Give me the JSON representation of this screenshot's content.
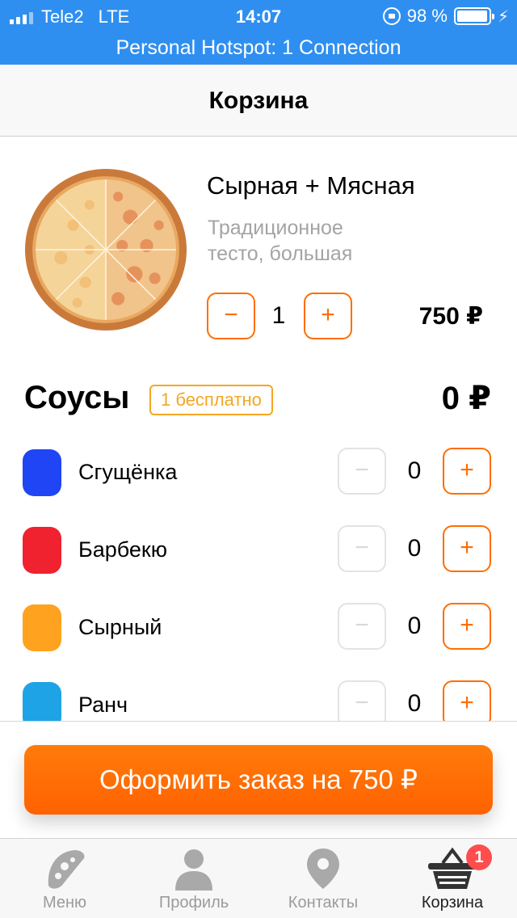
{
  "status_bar": {
    "carrier": "Tele2",
    "network": "LTE",
    "time": "14:07",
    "battery": "98 %",
    "battery_level": 0.98
  },
  "hotspot": "Personal Hotspot: 1 Connection",
  "nav": {
    "title": "Корзина"
  },
  "product": {
    "name": "Сырная + Мясная",
    "description": "Традиционное тесто, большая",
    "quantity": "1",
    "price": "750 ₽",
    "minus": "−",
    "plus": "+"
  },
  "sauces": {
    "title": "Соусы",
    "badge": "1 бесплатно",
    "total": "0 ₽",
    "items": [
      {
        "name": "Сгущёнка",
        "quantity": "0",
        "color": "#1f45f5"
      },
      {
        "name": "Барбекю",
        "quantity": "0",
        "color": "#f0222f"
      },
      {
        "name": "Сырный",
        "quantity": "0",
        "color": "#ffa21f"
      },
      {
        "name": "Ранч",
        "quantity": "0",
        "color": "#1ea3e6"
      }
    ]
  },
  "checkout": {
    "label": "Оформить заказ на 750 ₽"
  },
  "tabs": [
    {
      "label": "Меню",
      "icon": "pizza-slice-icon"
    },
    {
      "label": "Профиль",
      "icon": "person-icon"
    },
    {
      "label": "Контакты",
      "icon": "map-pin-icon"
    },
    {
      "label": "Корзина",
      "icon": "basket-icon",
      "badge": "1"
    }
  ],
  "colors": {
    "accent": "#ff6d00",
    "status_bar": "#2f8ff0",
    "badge_border": "#f5a623",
    "cart_badge": "#ff4d4d"
  }
}
